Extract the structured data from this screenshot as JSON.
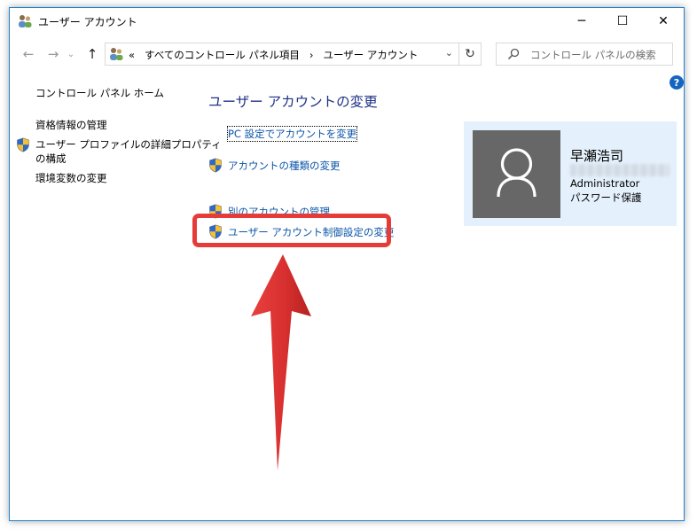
{
  "window": {
    "title": "ユーザー アカウント"
  },
  "titlebar": {
    "minimize": "─",
    "maximize": "☐",
    "close": "✕"
  },
  "nav": {
    "back": "←",
    "forward": "→",
    "recent": "⌄",
    "up": "↑",
    "refresh": "↻"
  },
  "address": {
    "overflow": "«",
    "path": [
      "すべてのコントロール パネル項目",
      "ユーザー アカウント"
    ],
    "separator": "›",
    "dropdown": "⌄"
  },
  "search": {
    "placeholder": "コントロール パネルの検索"
  },
  "help": {
    "label": "?"
  },
  "sidebar": {
    "home": "コントロール パネル ホーム",
    "items": [
      "資格情報の管理",
      "ユーザー プロファイルの詳細プロパティ",
      "の構成",
      "環境変数の変更"
    ]
  },
  "main": {
    "heading": "ユーザー アカウントの変更",
    "tasks": [
      "PC 設定でアカウントを変更",
      "アカウントの種類の変更",
      "別のアカウントの管理",
      "ユーザー アカウント制御設定の変更"
    ]
  },
  "account": {
    "name": "早瀬浩司",
    "role": "Administrator",
    "password_status": "パスワード保護"
  },
  "colors": {
    "accent_border": "#1883d7",
    "link": "#0b55a8",
    "heading": "#1e3287",
    "highlight": "#e53c3a",
    "card_bg": "#e4f0fb",
    "avatar_bg": "#676767"
  }
}
